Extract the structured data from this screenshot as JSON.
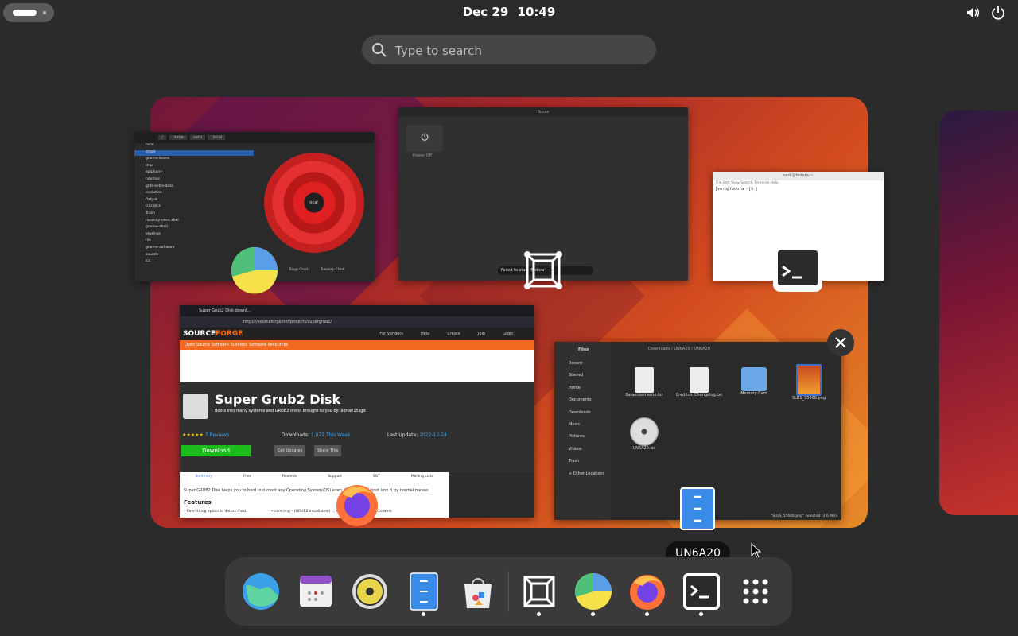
{
  "topbar": {
    "date": "Dec 29",
    "time": "10:49"
  },
  "search": {
    "placeholder": "Type to search"
  },
  "windows": {
    "baobab": {
      "path": [
        "/",
        "home",
        "verb",
        ".local"
      ],
      "rows": [
        "local",
        "share",
        "gnome-boxes",
        "tmp",
        "epiphany",
        "nautilus",
        "gnfs-extra-data",
        "evolution",
        "flatpak",
        "tracker3",
        "Trash",
        "recently-used.xbel",
        "gnome-shell",
        "keyrings",
        "nix",
        "gnome-software",
        "sounds",
        "icc"
      ],
      "ring_label": "local",
      "buttons": [
        "Rings Chart",
        "Treemap Chart"
      ]
    },
    "gnome_app": {
      "title": "Boxes",
      "power_label": "Power Off",
      "toast": "Failed to start 'Fedora' — ..."
    },
    "terminal": {
      "title": "verb@fedora:~",
      "menu": "File  Edit  View  Search  Terminal  Help",
      "prompt": "[verb@fedora ~]$ |"
    },
    "firefox": {
      "tab": "Super Grub2 Disk downl...",
      "url": "https://sourceforge.net/projects/supergrub2/",
      "logo_prefix": "SOURCE",
      "logo_suffix": "FORGE",
      "sf_nav": [
        "For Vendors",
        "Help",
        "Create",
        "Join",
        "Login"
      ],
      "orange_links": "Open Source Software    Business Software    Resources",
      "page_title": "Super Grub2 Disk",
      "page_sub": "Boots into many systems and GRUB2 ones! Brought to you by: adrian15sgd",
      "stars": "★★★★★",
      "reviews": "7 Reviews",
      "downloads_label": "Downloads:",
      "downloads_value": "1,872 This Week",
      "last_update_label": "Last Update:",
      "last_update_value": "2022-12-24",
      "download_button": "Download",
      "get_updates": "Get Updates",
      "share": "Share This",
      "subtabs": [
        "Summary",
        "Files",
        "Reviews",
        "Support",
        "SGT",
        "Mailing Lists"
      ],
      "description": "Super GRUB2 Disk helps you to boot into most any Operating System(OS) even if you cannot boot into it by normal means.",
      "features_title": "Features",
      "feature1": "• Everything option to detect most",
      "feature2": "• core.img – (GRUB2 installation) ... GRUB2's PATA support (to work"
    },
    "files": {
      "title": "Files",
      "breadcrumb": "Downloads / UN6A20 / UN6A20",
      "sidebar": [
        "Recent",
        "Starred",
        "Home",
        "Documents",
        "Downloads",
        "Music",
        "Pictures",
        "Videos",
        "Trash",
        "+ Other Locations"
      ],
      "items": [
        "Balanceamento.txt",
        "Créditos_Changelog.txt",
        "Memory Card",
        "SLUS_55606.png",
        "UN6A20.iso"
      ],
      "status": "\"SLUS_55606.png\" selected (2.6 MB)"
    }
  },
  "tooltip": "UN6A20",
  "dash": {
    "apps": [
      "Web Browser",
      "Calendar",
      "Rhythmbox",
      "Files",
      "Software",
      "Boxes",
      "Disk Usage Analyzer",
      "Firefox",
      "Terminal",
      "Show Applications"
    ]
  },
  "colors": {
    "accent": "#3584e4",
    "sourceforge_orange": "#f26a21",
    "download_green": "#1cbc1c"
  }
}
